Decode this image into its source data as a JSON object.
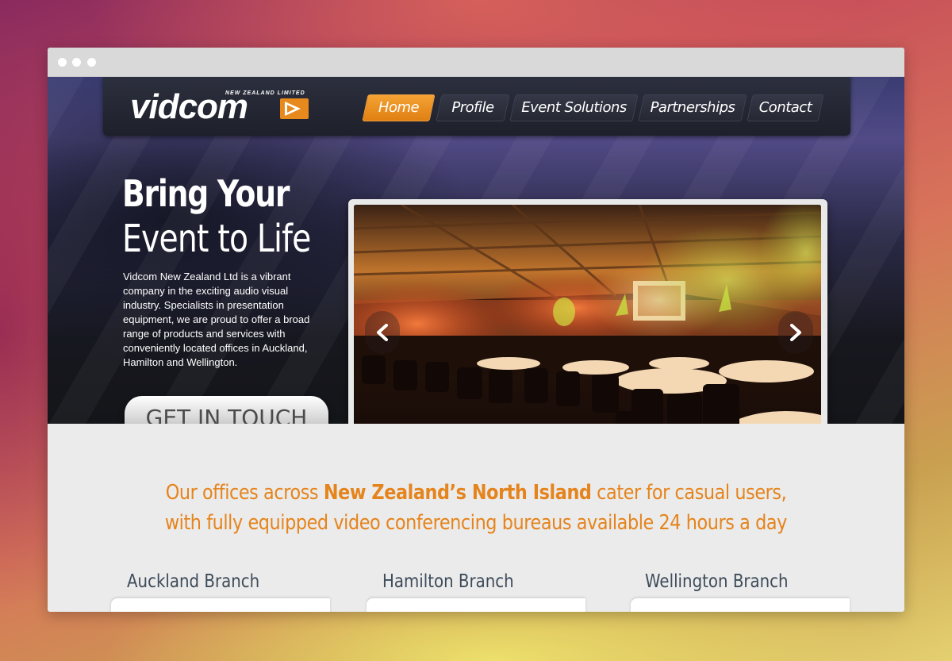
{
  "brand": {
    "name": "vidcom",
    "tagline": "NEW ZEALAND LIMITED",
    "accent_color": "#e5841c",
    "logo_icon": "play-icon"
  },
  "nav": {
    "items": [
      {
        "label": "Home",
        "active": true
      },
      {
        "label": "Profile",
        "active": false
      },
      {
        "label": "Event Solutions",
        "active": false
      },
      {
        "label": "Partnerships",
        "active": false
      },
      {
        "label": "Contact",
        "active": false
      }
    ]
  },
  "hero": {
    "headline_line1": "Bring Your",
    "headline_line2": "Event to Life",
    "intro": "Vidcom New Zealand Ltd is a vibrant company in the exciting audio visual industry. Specialists in presentation equipment, we are proud to offer a broad range of products and services with conveniently located offices in Auckland, Hamilton and Wellington.",
    "cta_label": "GET IN TOUCH"
  },
  "slider": {
    "prev_icon": "chevron-left-icon",
    "next_icon": "chevron-right-icon"
  },
  "offices": {
    "line1_pre": "Our offices across ",
    "line1_bold": "New Zealand’s North Island",
    "line1_post": " cater for casual users,",
    "line2": "with fully equipped video conferencing bureaus available 24 hours a day"
  },
  "branches": [
    {
      "title": "Auckland Branch"
    },
    {
      "title": "Hamilton Branch"
    },
    {
      "title": "Wellington Branch"
    }
  ]
}
